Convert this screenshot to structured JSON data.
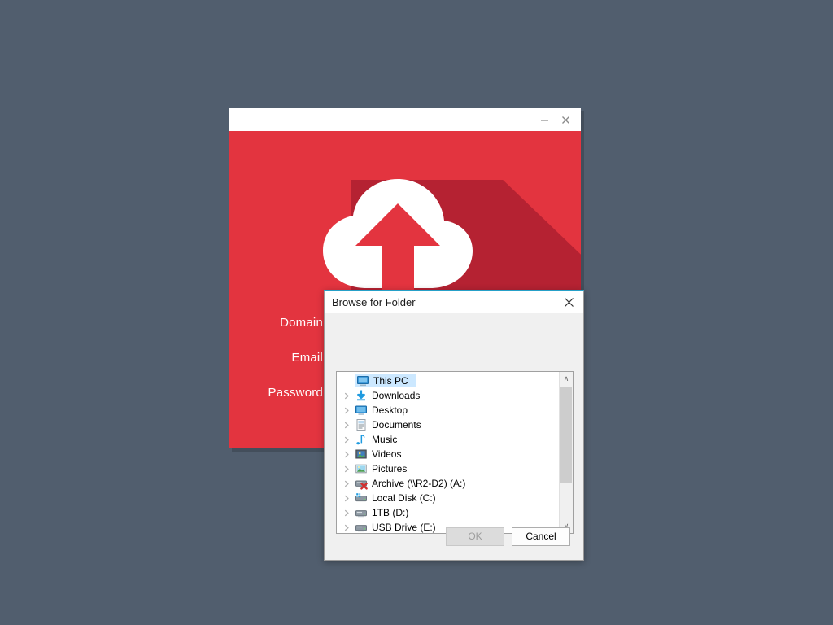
{
  "desktop": {
    "background_color": "#515e6e"
  },
  "app_window": {
    "title": "",
    "background_color": "#e3343f",
    "shadow_color": "#b52232",
    "logo_icon": "cloud-upload-icon",
    "controls": {
      "minimize_label": "–",
      "minimize_icon": "minimize-icon",
      "close_label": "✕",
      "close_icon": "close-icon"
    },
    "form": {
      "fields": [
        {
          "label": "Domain",
          "value": "",
          "placeholder": ""
        },
        {
          "label": "Email",
          "value": "",
          "placeholder": ""
        },
        {
          "label": "Password",
          "value": "",
          "placeholder": ""
        }
      ]
    }
  },
  "browse_dialog": {
    "title": "Browse for Folder",
    "close_icon": "close-icon",
    "close_label": "✕",
    "accent_color": "#26a0c8",
    "tree": {
      "selected_index": 0,
      "items": [
        {
          "label": "This PC",
          "icon": "computer-icon",
          "expandable": false,
          "indent": 0,
          "selected": true
        },
        {
          "label": "Downloads",
          "icon": "downloads-icon",
          "expandable": true,
          "indent": 1,
          "selected": false
        },
        {
          "label": "Desktop",
          "icon": "desktop-icon",
          "expandable": true,
          "indent": 1,
          "selected": false
        },
        {
          "label": "Documents",
          "icon": "documents-icon",
          "expandable": true,
          "indent": 1,
          "selected": false
        },
        {
          "label": "Music",
          "icon": "music-icon",
          "expandable": true,
          "indent": 1,
          "selected": false
        },
        {
          "label": "Videos",
          "icon": "videos-icon",
          "expandable": true,
          "indent": 1,
          "selected": false
        },
        {
          "label": "Pictures",
          "icon": "pictures-icon",
          "expandable": true,
          "indent": 1,
          "selected": false
        },
        {
          "label": "Archive (\\\\R2-D2) (A:)",
          "icon": "network-drive-disconnected-icon",
          "expandable": true,
          "indent": 1,
          "selected": false
        },
        {
          "label": "Local Disk (C:)",
          "icon": "system-drive-icon",
          "expandable": true,
          "indent": 1,
          "selected": false
        },
        {
          "label": "1TB (D:)",
          "icon": "drive-icon",
          "expandable": true,
          "indent": 1,
          "selected": false
        },
        {
          "label": "USB Drive (E:)",
          "icon": "drive-icon",
          "expandable": true,
          "indent": 1,
          "selected": false
        }
      ]
    },
    "scrollbar": {
      "up_arrow": "∧",
      "down_arrow": "∨",
      "up_icon": "scroll-up-icon",
      "down_icon": "scroll-down-icon"
    },
    "buttons": {
      "ok_label": "OK",
      "ok_enabled": false,
      "cancel_label": "Cancel",
      "cancel_enabled": true
    }
  }
}
